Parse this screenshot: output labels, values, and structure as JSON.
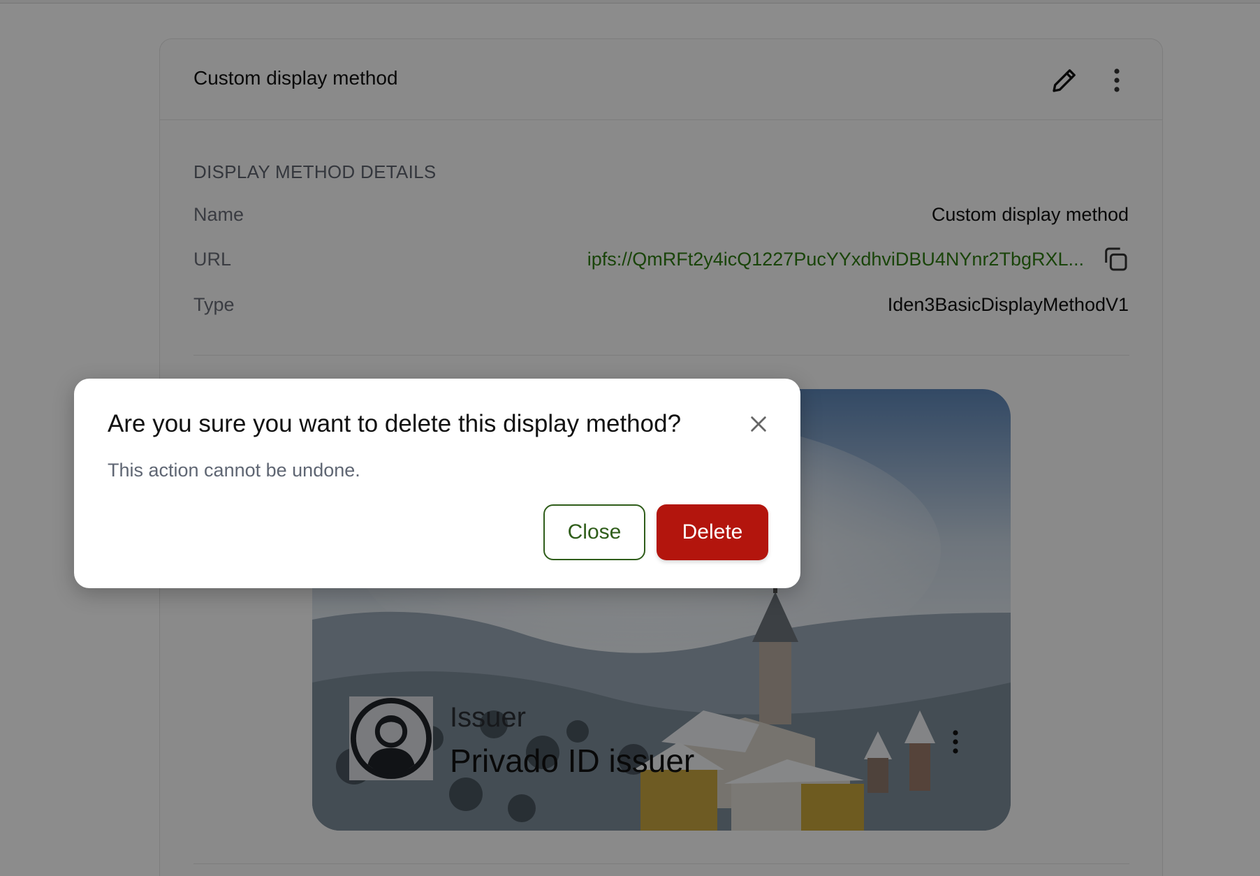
{
  "card": {
    "title": "Custom display method",
    "edit_icon": "pencil-icon",
    "more_icon": "vertical-dots-icon",
    "section_label": "DISPLAY METHOD DETAILS",
    "rows": [
      {
        "label": "Name",
        "value": "Custom display method"
      },
      {
        "label": "URL",
        "value": "ipfs://QmRFt2y4icQ1227PucYYxdhviDBU4NYnr2TbgRXL..."
      },
      {
        "label": "Type",
        "value": "Iden3BasicDisplayMethodV1"
      }
    ],
    "copy_icon": "copy-icon"
  },
  "preview": {
    "issuer_label": "Issuer",
    "issuer_name": "Privado ID issuer",
    "avatar_icon": "user-avatar-icon",
    "more_icon": "vertical-dots-icon"
  },
  "modal": {
    "title": "Are you sure you want to delete this display method?",
    "description": "This action cannot be undone.",
    "close_icon": "close-icon",
    "close_button": "Close",
    "delete_button": "Delete"
  },
  "colors": {
    "link": "#2f7d12",
    "danger": "#b3150d",
    "outline": "#2f5d1a"
  }
}
